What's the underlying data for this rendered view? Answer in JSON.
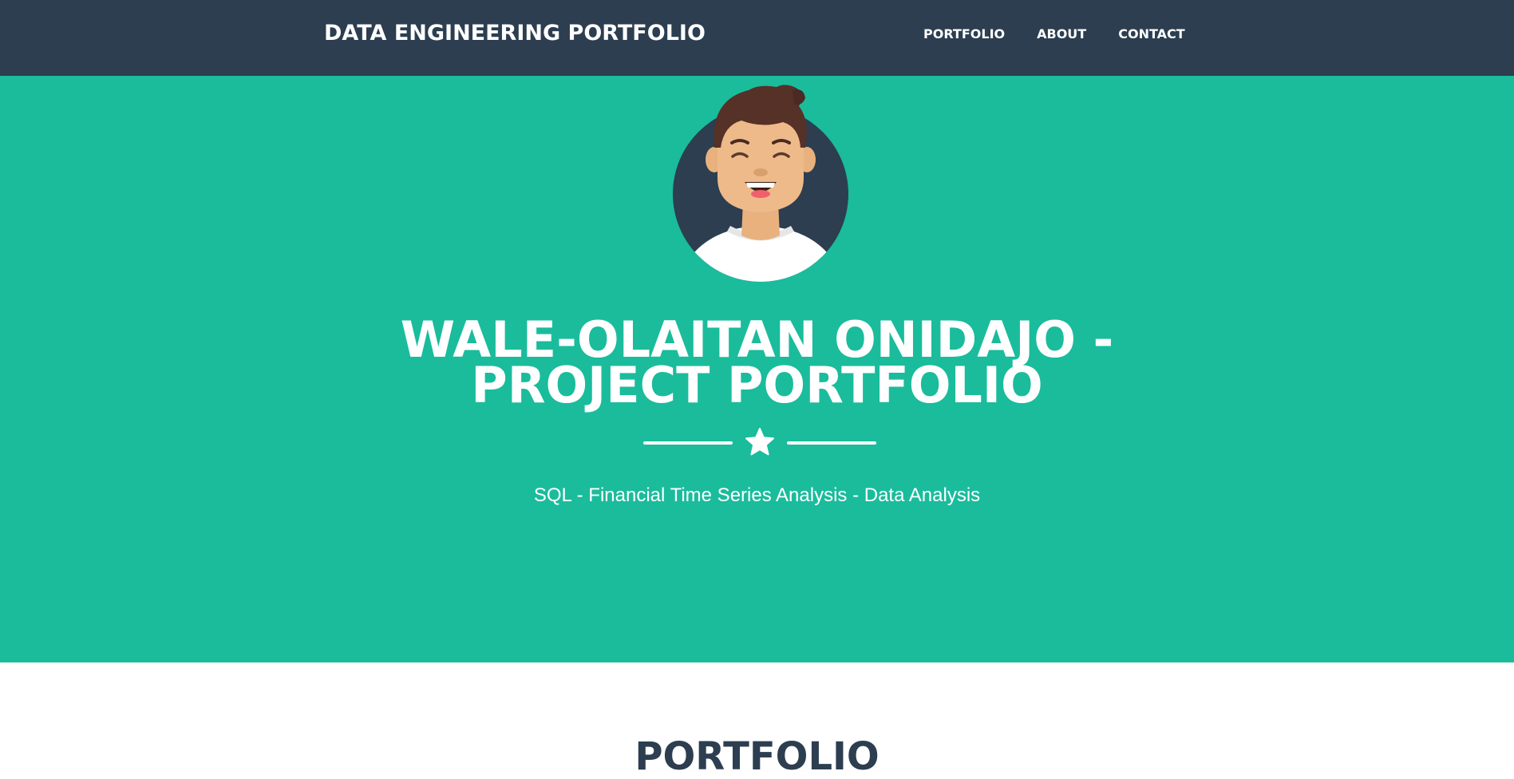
{
  "navbar": {
    "brand": "DATA ENGINEERING PORTFOLIO",
    "links": [
      {
        "label": "PORTFOLIO"
      },
      {
        "label": "ABOUT"
      },
      {
        "label": "CONTACT"
      }
    ]
  },
  "hero": {
    "title_line1": "WALE-OLAITAN ONIDAJO -",
    "title_line2": "PROJECT PORTFOLIO",
    "subtitle": "SQL - Financial Time Series Analysis - Data Analysis",
    "divider_icon": "star-icon"
  },
  "portfolio": {
    "heading": "PORTFOLIO"
  },
  "colors": {
    "navbar_bg": "#2c3e50",
    "hero_bg": "#1abc9c",
    "heading_text": "#2c3e50",
    "white": "#ffffff"
  }
}
